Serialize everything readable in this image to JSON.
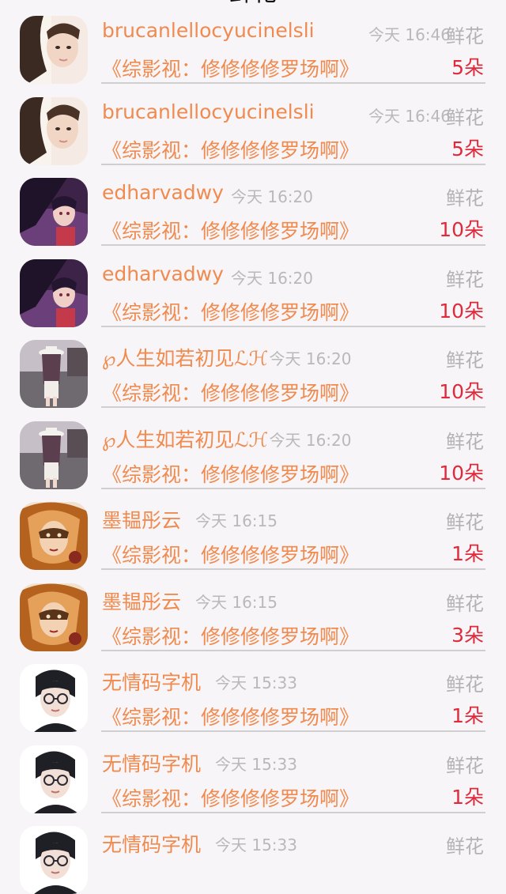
{
  "nav": {
    "title": "鲜花"
  },
  "items": [
    {
      "name": "brucanlellocyucinelsli",
      "time": "今天 16:46",
      "gift": "鲜花",
      "book": "《综影视：修修修修罗场啊》",
      "count": "5朵",
      "avatar": "avatar-girl-portrait",
      "accent": "#f2d7c6"
    },
    {
      "name": "brucanlellocyucinelsli",
      "time": "今天 16:46",
      "gift": "鲜花",
      "book": "《综影视：修修修修罗场啊》",
      "count": "5朵",
      "avatar": "avatar-girl-portrait",
      "accent": "#f2d7c6"
    },
    {
      "name": "edharvadwy",
      "time": "今天 16:20",
      "gift": "鲜花",
      "book": "《综影视：修修修修罗场啊》",
      "count": "10朵",
      "avatar": "avatar-anime-girl",
      "accent": "#8e5c9c"
    },
    {
      "name": "edharvadwy",
      "time": "今天 16:20",
      "gift": "鲜花",
      "book": "《综影视：修修修修罗场啊》",
      "count": "10朵",
      "avatar": "avatar-anime-girl",
      "accent": "#8e5c9c"
    },
    {
      "name": "℘人生如若初见ℒℋ",
      "time": "今天 16:20",
      "gift": "鲜花",
      "book": "《综影视：修修修修罗场啊》",
      "count": "10朵",
      "avatar": "avatar-girl-hat",
      "accent": "#7a5a63"
    },
    {
      "name": "℘人生如若初见ℒℋ",
      "time": "今天 16:20",
      "gift": "鲜花",
      "book": "《综影视：修修修修罗场啊》",
      "count": "10朵",
      "avatar": "avatar-girl-hat",
      "accent": "#7a5a63"
    },
    {
      "name": "墨韫彤云",
      "time": "今天 16:15",
      "gift": "鲜花",
      "book": "《综影视：修修修修罗场啊》",
      "count": "1朵",
      "avatar": "avatar-masked-art",
      "accent": "#c77a3a"
    },
    {
      "name": "墨韫彤云",
      "time": "今天 16:15",
      "gift": "鲜花",
      "book": "《综影视：修修修修罗场啊》",
      "count": "3朵",
      "avatar": "avatar-masked-art",
      "accent": "#c77a3a"
    },
    {
      "name": "无情码字机",
      "time": "今天 15:33",
      "gift": "鲜花",
      "book": "《综影视：修修修修罗场啊》",
      "count": "1朵",
      "avatar": "avatar-boy-glasses",
      "accent": "#2b2b35"
    },
    {
      "name": "无情码字机",
      "time": "今天 15:33",
      "gift": "鲜花",
      "book": "《综影视：修修修修罗场啊》",
      "count": "1朵",
      "avatar": "avatar-boy-glasses",
      "accent": "#2b2b35"
    },
    {
      "name": "无情码字机",
      "time": "今天 15:33",
      "gift": "鲜花",
      "book": "",
      "count": "",
      "avatar": "avatar-boy-glasses",
      "accent": "#2b2b35"
    }
  ]
}
